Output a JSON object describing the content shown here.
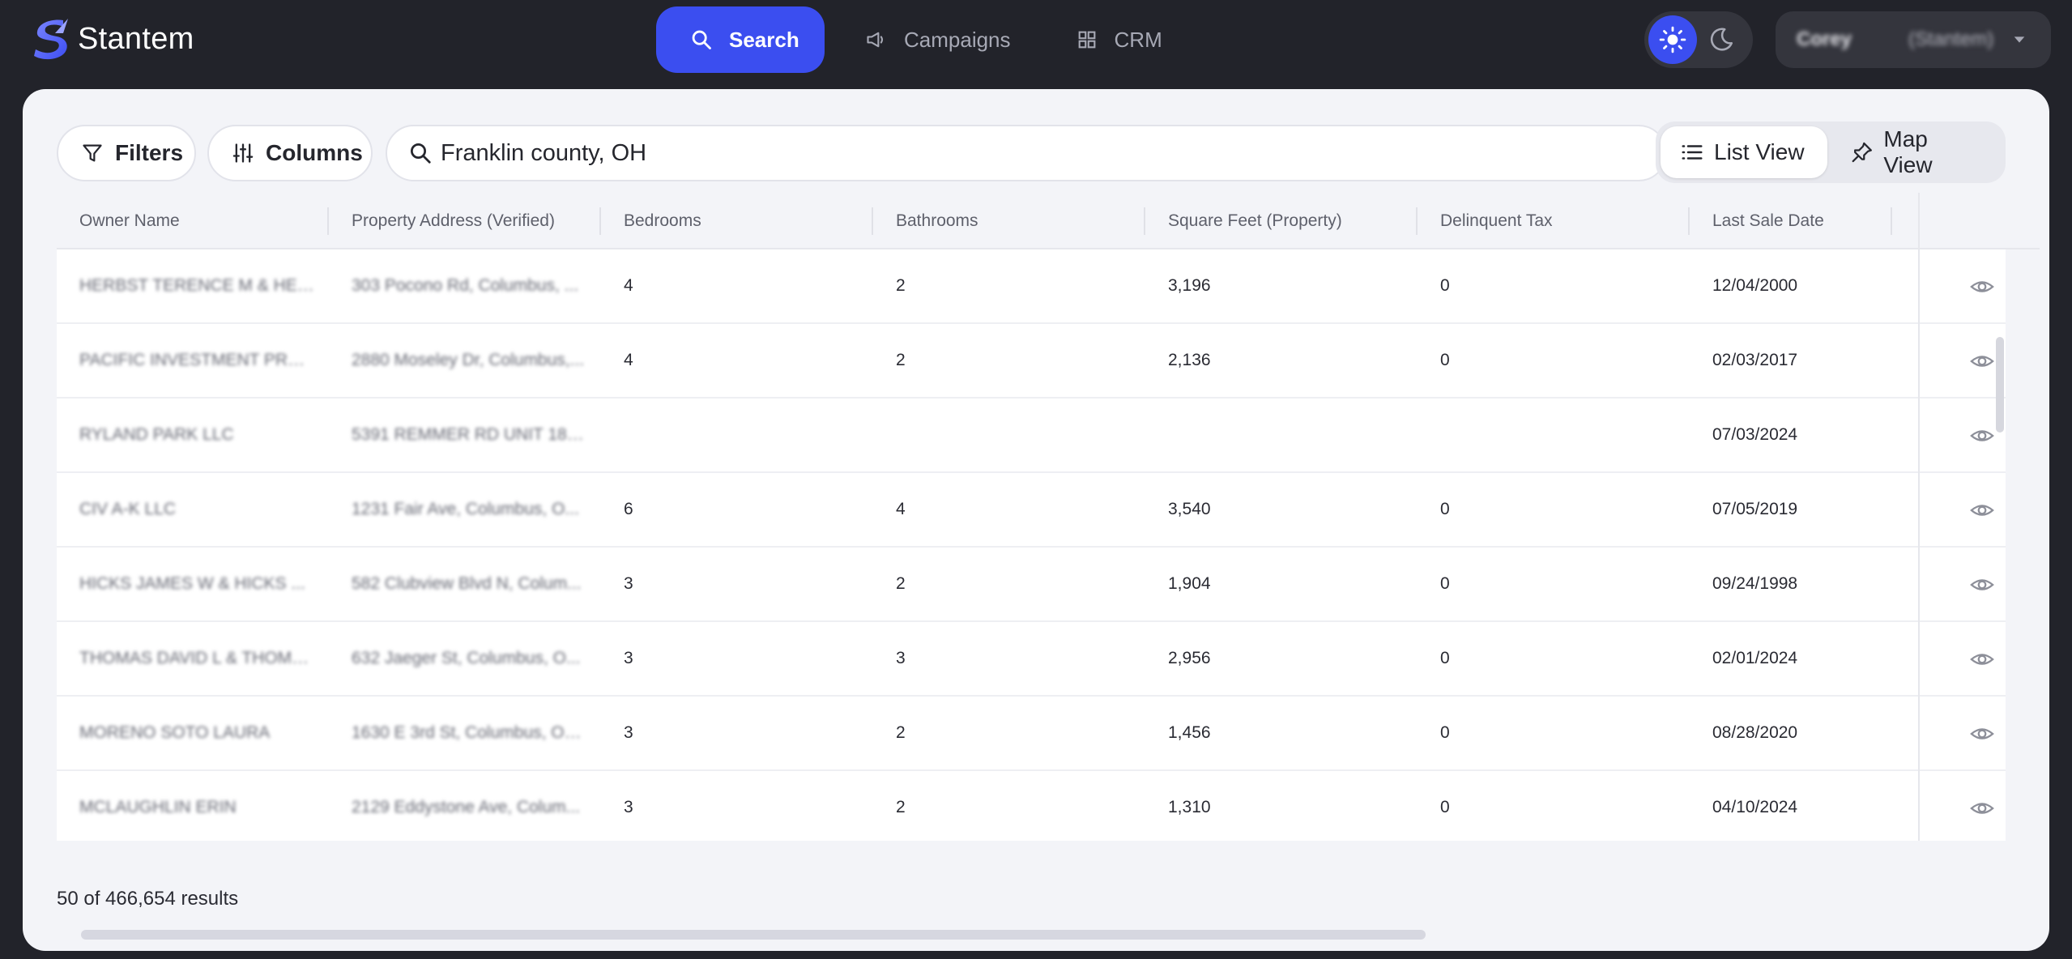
{
  "brand": {
    "name": "Stantem"
  },
  "nav": {
    "items": [
      {
        "label": "Search",
        "icon": "search-icon",
        "active": true
      },
      {
        "label": "Campaigns",
        "icon": "megaphone-icon",
        "active": false
      },
      {
        "label": "CRM",
        "icon": "grid-icon",
        "active": false
      }
    ]
  },
  "theme": {
    "active": "light"
  },
  "user": {
    "name": "Corey",
    "org": "(Stantem)"
  },
  "toolbar": {
    "filters_label": "Filters",
    "columns_label": "Columns",
    "search_value": "Franklin county, OH",
    "list_view_label": "List View",
    "map_view_label": "Map View",
    "active_view": "list"
  },
  "table": {
    "columns": [
      "Owner Name",
      "Property Address (Verified)",
      "Bedrooms",
      "Bathrooms",
      "Square Feet (Property)",
      "Delinquent Tax",
      "Last Sale Date"
    ],
    "rows": [
      {
        "owner": "HERBST TERENCE M & HER...",
        "address": "303 Pocono Rd, Columbus, ...",
        "bedrooms": "4",
        "bathrooms": "2",
        "sqft": "3,196",
        "tax": "0",
        "sale_date": "12/04/2000"
      },
      {
        "owner": "PACIFIC INVESTMENT PRO...",
        "address": "2880 Moseley Dr, Columbus,...",
        "bedrooms": "4",
        "bathrooms": "2",
        "sqft": "2,136",
        "tax": "0",
        "sale_date": "02/03/2017"
      },
      {
        "owner": "RYLAND PARK LLC",
        "address": "5391 REMMER RD UNIT 185...",
        "bedrooms": "",
        "bathrooms": "",
        "sqft": "",
        "tax": "",
        "sale_date": "07/03/2024"
      },
      {
        "owner": "CIV A-K LLC",
        "address": "1231 Fair Ave, Columbus, O...",
        "bedrooms": "6",
        "bathrooms": "4",
        "sqft": "3,540",
        "tax": "0",
        "sale_date": "07/05/2019"
      },
      {
        "owner": "HICKS JAMES W & HICKS ...",
        "address": "582 Clubview Blvd N, Colum...",
        "bedrooms": "3",
        "bathrooms": "2",
        "sqft": "1,904",
        "tax": "0",
        "sale_date": "09/24/1998"
      },
      {
        "owner": "THOMAS DAVID L & THOMP...",
        "address": "632 Jaeger St, Columbus, O...",
        "bedrooms": "3",
        "bathrooms": "3",
        "sqft": "2,956",
        "tax": "0",
        "sale_date": "02/01/2024"
      },
      {
        "owner": "MORENO SOTO LAURA",
        "address": "1630 E 3rd St, Columbus, Oh...",
        "bedrooms": "3",
        "bathrooms": "2",
        "sqft": "1,456",
        "tax": "0",
        "sale_date": "08/28/2020"
      },
      {
        "owner": "MCLAUGHLIN ERIN",
        "address": "2129 Eddystone Ave, Colum...",
        "bedrooms": "3",
        "bathrooms": "2",
        "sqft": "1,310",
        "tax": "0",
        "sale_date": "04/10/2024"
      }
    ]
  },
  "footer": {
    "results_text": "50 of 466,654 results"
  },
  "colors": {
    "accent": "#3b4ef0",
    "topbar_bg": "#22232a",
    "panel_bg": "#f3f4f8"
  }
}
